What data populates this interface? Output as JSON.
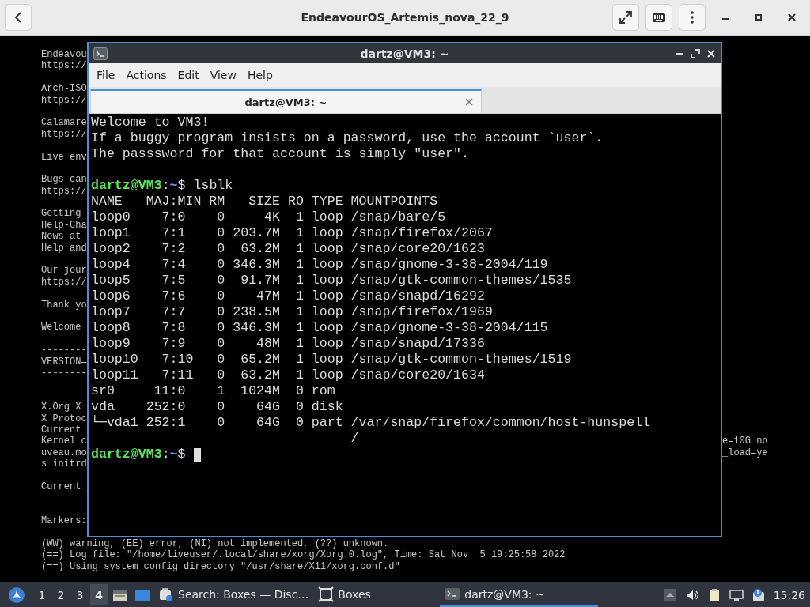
{
  "header": {
    "title": "EndeavourOS_Artemis_nova_22_9"
  },
  "console": {
    "lines": [
      {
        "kind": "text",
        "text": "Endeavou"
      },
      {
        "kind": "text",
        "text": "https://"
      },
      {
        "kind": "blank"
      },
      {
        "kind": "text",
        "text": "Arch-ISO"
      },
      {
        "kind": "text",
        "text": "https://"
      },
      {
        "kind": "blank"
      },
      {
        "kind": "text",
        "text": "Calamare"
      },
      {
        "kind": "text",
        "text": "https://"
      },
      {
        "kind": "blank"
      },
      {
        "kind": "text",
        "text": "Live env"
      },
      {
        "kind": "blank"
      },
      {
        "kind": "text",
        "text": "Bugs can"
      },
      {
        "kind": "text",
        "text": "https://"
      },
      {
        "kind": "blank"
      },
      {
        "kind": "text",
        "text": "Getting"
      },
      {
        "kind": "text",
        "text": "Help-Cha"
      },
      {
        "kind": "text",
        "text": "News at"
      },
      {
        "kind": "text",
        "text": "Help and"
      },
      {
        "kind": "blank"
      },
      {
        "kind": "text",
        "text": "Our jour"
      },
      {
        "kind": "text",
        "text": "https://"
      },
      {
        "kind": "blank"
      },
      {
        "kind": "text",
        "text": "Thank yo"
      },
      {
        "kind": "blank"
      },
      {
        "kind": "text",
        "text": "Welcome"
      },
      {
        "kind": "blank"
      },
      {
        "kind": "text",
        "text": "--------"
      },
      {
        "kind": "text",
        "text": "VERSION="
      },
      {
        "kind": "text",
        "text": "--------"
      },
      {
        "kind": "blank"
      },
      {
        "kind": "blank"
      },
      {
        "kind": "text",
        "text": "X.Org X"
      },
      {
        "kind": "text",
        "text": "X Protoc"
      },
      {
        "kind": "text",
        "text": "Current"
      },
      {
        "kind": "text",
        "text": "Kernel c",
        "tail": "e=10G no"
      },
      {
        "kind": "text",
        "text": "uveau.mo",
        "tail": "_load=ye"
      },
      {
        "kind": "text",
        "text": "s initrd"
      },
      {
        "kind": "blank"
      },
      {
        "kind": "text",
        "text": "Current"
      },
      {
        "kind": "blank"
      },
      {
        "kind": "blank"
      },
      {
        "kind": "text",
        "text": "Markers:"
      },
      {
        "kind": "blank"
      },
      {
        "kind": "text",
        "text": "(WW) warning, (EE) error, (NI) not implemented, (??) unknown."
      },
      {
        "kind": "text",
        "text": "(==) Log file: \"/home/liveuser/.local/share/xorg/Xorg.0.log\", Time: Sat Nov  5 19:25:58 2022"
      },
      {
        "kind": "text",
        "text": "(==) Using system config directory \"/usr/share/X11/xorg.conf.d\""
      }
    ]
  },
  "terminal": {
    "title": "dartz@VM3: ~",
    "menu": [
      "File",
      "Actions",
      "Edit",
      "View",
      "Help"
    ],
    "tabs": [
      {
        "label": "dartz@VM3: ~",
        "selected": true
      }
    ],
    "lines": [
      {
        "kind": "text",
        "text": "Welcome to VM3!"
      },
      {
        "kind": "text",
        "text": "If a buggy program insists on a password, use the account `user`."
      },
      {
        "kind": "text",
        "text": "The passsword for that account is simply \"user\"."
      },
      {
        "kind": "blank"
      },
      {
        "kind": "prompt",
        "user_host": "dartz@VM3",
        "separator": ":",
        "path": "~",
        "symbol": "$",
        "command": "lsblk"
      },
      {
        "kind": "text",
        "text": "NAME   MAJ:MIN RM   SIZE RO TYPE MOUNTPOINTS"
      },
      {
        "kind": "text",
        "text": "loop0    7:0    0     4K  1 loop /snap/bare/5"
      },
      {
        "kind": "text",
        "text": "loop1    7:1    0 203.7M  1 loop /snap/firefox/2067"
      },
      {
        "kind": "text",
        "text": "loop2    7:2    0  63.2M  1 loop /snap/core20/1623"
      },
      {
        "kind": "text",
        "text": "loop4    7:4    0 346.3M  1 loop /snap/gnome-3-38-2004/119"
      },
      {
        "kind": "text",
        "text": "loop5    7:5    0  91.7M  1 loop /snap/gtk-common-themes/1535"
      },
      {
        "kind": "text",
        "text": "loop6    7:6    0    47M  1 loop /snap/snapd/16292"
      },
      {
        "kind": "text",
        "text": "loop7    7:7    0 238.5M  1 loop /snap/firefox/1969"
      },
      {
        "kind": "text",
        "text": "loop8    7:8    0 346.3M  1 loop /snap/gnome-3-38-2004/115"
      },
      {
        "kind": "text",
        "text": "loop9    7:9    0    48M  1 loop /snap/snapd/17336"
      },
      {
        "kind": "text",
        "text": "loop10   7:10   0  65.2M  1 loop /snap/gtk-common-themes/1519"
      },
      {
        "kind": "text",
        "text": "loop11   7:11   0  63.2M  1 loop /snap/core20/1634"
      },
      {
        "kind": "text",
        "text": "sr0     11:0    1  1024M  0 rom"
      },
      {
        "kind": "text",
        "text": "vda    252:0    0    64G  0 disk"
      },
      {
        "kind": "text",
        "text": "└─vda1 252:1    0    64G  0 part /var/snap/firefox/common/host-hunspell"
      },
      {
        "kind": "text",
        "text": "                                 /"
      },
      {
        "kind": "prompt",
        "user_host": "dartz@VM3",
        "separator": ":",
        "path": "~",
        "symbol": "$",
        "cursor": true
      }
    ]
  },
  "taskbar": {
    "workspaces": [
      {
        "label": "1",
        "selected": false
      },
      {
        "label": "2",
        "selected": false
      },
      {
        "label": "3",
        "selected": false
      },
      {
        "label": "4",
        "selected": true
      }
    ],
    "tasks": [
      {
        "kind": "store",
        "label": "Search: Boxes — Disc…",
        "selected": false
      },
      {
        "kind": "boxes",
        "label": "Boxes",
        "selected": false
      },
      {
        "kind": "terminal",
        "label": "dartz@VM3: ~",
        "selected": true
      }
    ],
    "clock": "15:26"
  }
}
